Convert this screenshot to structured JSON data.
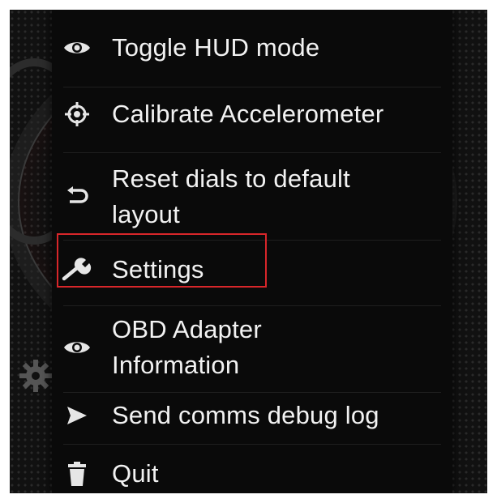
{
  "menu": {
    "items": [
      {
        "label": "Toggle HUD mode",
        "icon": "eye-icon"
      },
      {
        "label": "Calibrate Accelerometer",
        "icon": "crosshair-icon"
      },
      {
        "label": "Reset dials to default\nlayout",
        "icon": "undo-arrow-icon"
      },
      {
        "label": "Settings",
        "icon": "wrench-icon"
      },
      {
        "label": "OBD Adapter\nInformation",
        "icon": "eye-icon"
      },
      {
        "label": "Send comms debug log",
        "icon": "send-icon"
      },
      {
        "label": "Quit",
        "icon": "trash-icon"
      }
    ]
  },
  "highlight": {
    "target": "Settings",
    "color": "#d8262a"
  },
  "background": {
    "icon": "gear-icon"
  }
}
